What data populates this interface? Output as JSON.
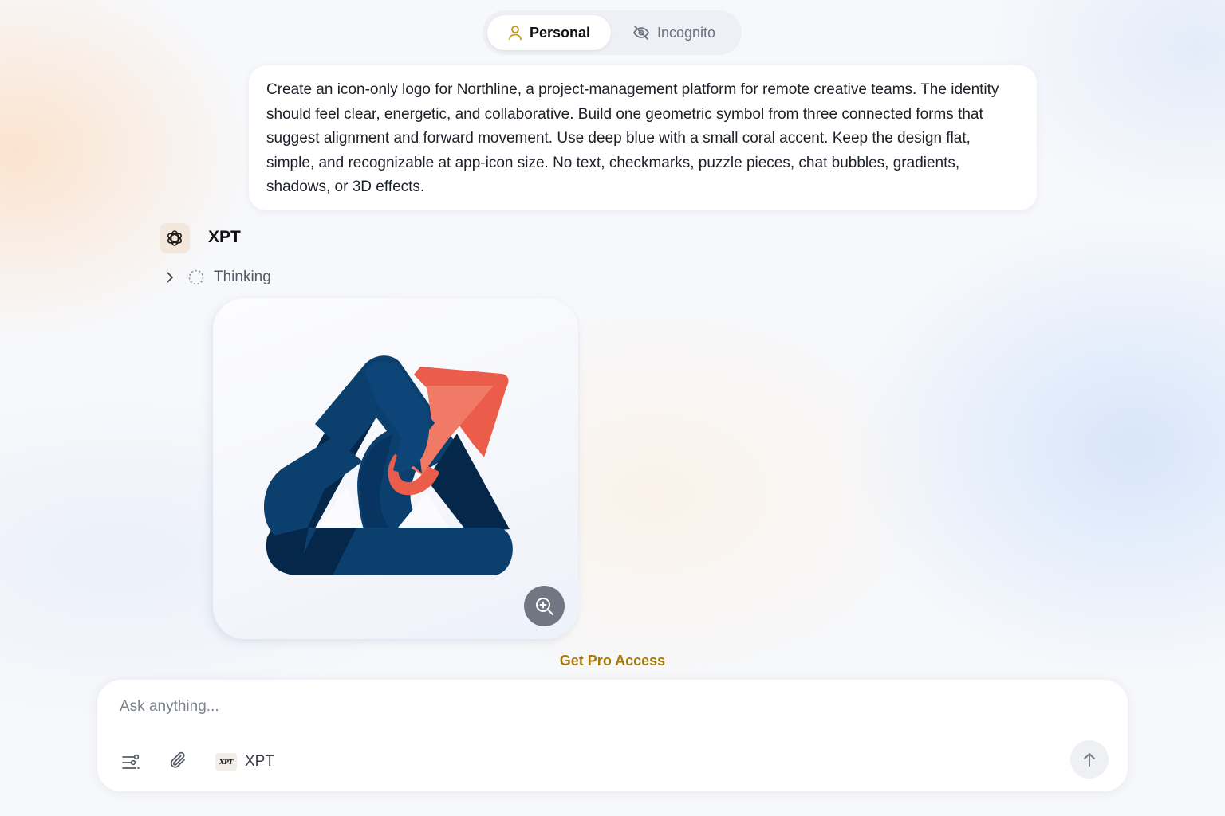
{
  "mode_toggle": {
    "personal_label": "Personal",
    "incognito_label": "Incognito",
    "active": "personal"
  },
  "prompt": {
    "text": "Create an icon-only logo for Northline, a project-management platform for remote creative teams. The identity should feel clear, energetic, and collaborative. Build one geometric symbol from three connected forms that suggest alignment and forward movement. Use deep blue with a small coral accent. Keep the design flat, simple, and recognizable at app-icon size. No text, checkmarks, puzzle pieces, chat bubbles, gradients, shadows, or 3D effects."
  },
  "assistant": {
    "name": "XPT",
    "thinking_label": "Thinking"
  },
  "pro_link": "Get Pro Access",
  "composer": {
    "placeholder": "Ask anything...",
    "model_badge": "XPT",
    "model_label": "XPT"
  },
  "colors": {
    "accent_gold": "#a8780a",
    "logo_blue": "#0a3f6e",
    "logo_blue_dark": "#05284a",
    "logo_coral": "#ec5c4a"
  },
  "icons": {
    "personal": "user-icon",
    "incognito": "eye-off-icon",
    "avatar": "openai-knot-icon",
    "zoom": "zoom-in-icon",
    "tools": "sliders-icon",
    "attach": "paperclip-icon",
    "send": "arrow-up-icon"
  }
}
